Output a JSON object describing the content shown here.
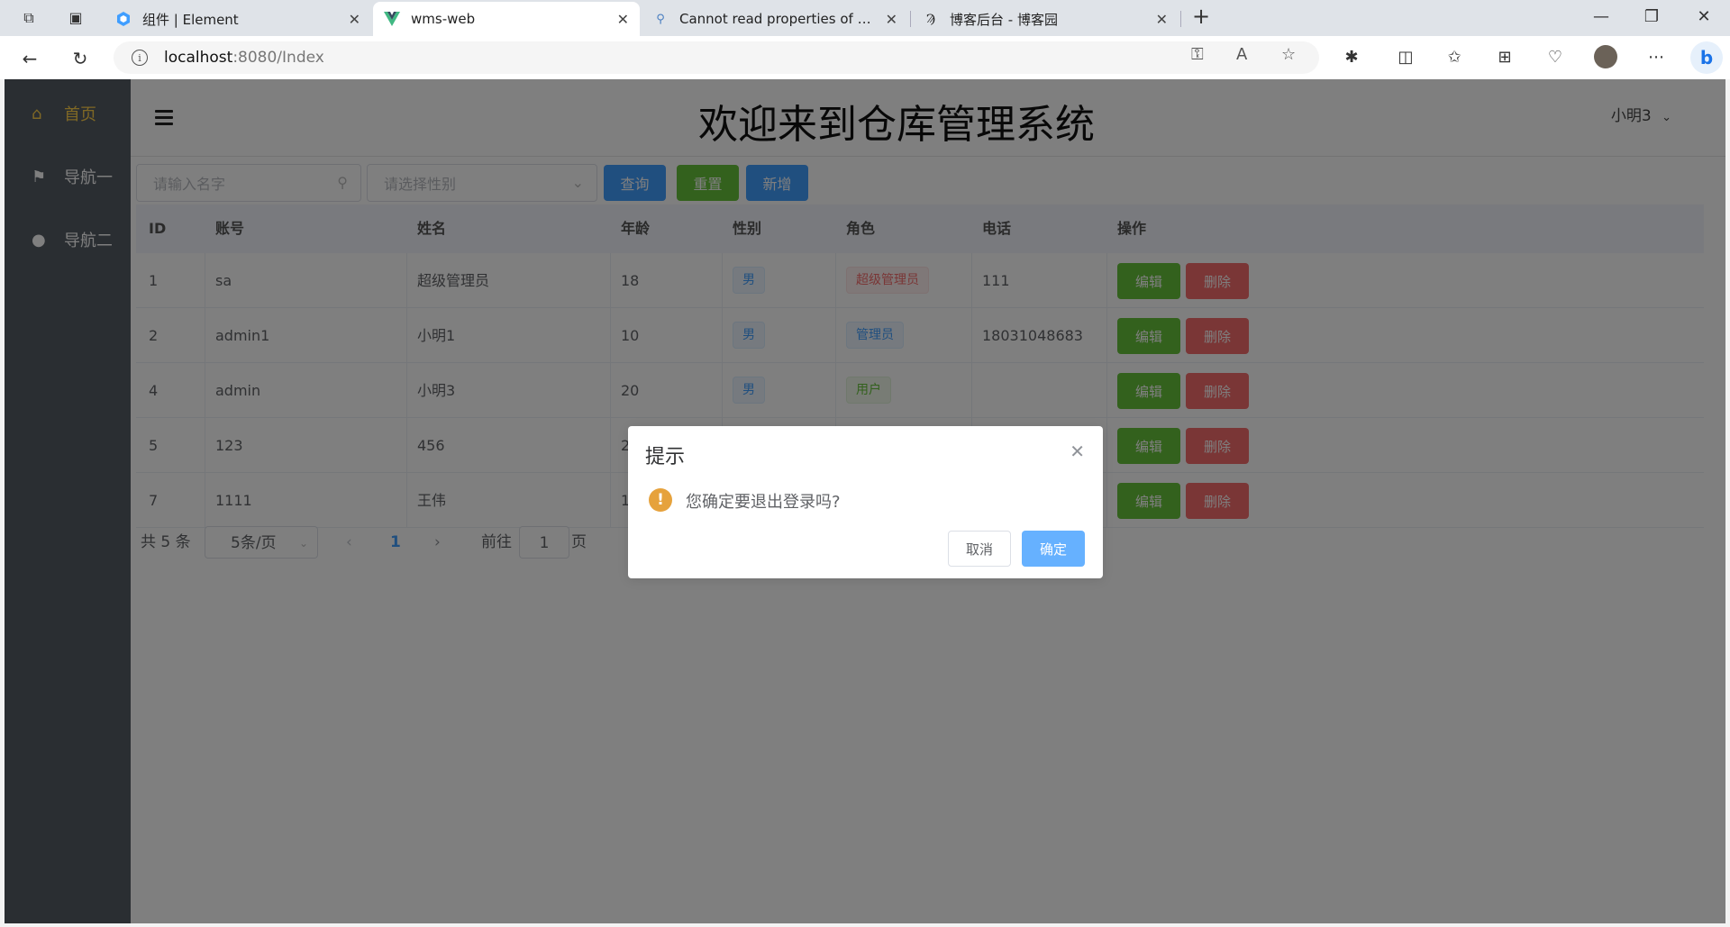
{
  "browser": {
    "tabs": [
      {
        "title": "组件 | Element",
        "icon": "element-icon"
      },
      {
        "title": "wms-web",
        "icon": "vue-icon"
      },
      {
        "title": "Cannot read properties of undefined",
        "icon": "search-icon"
      },
      {
        "title": "博客后台 - 博客园",
        "icon": "cnblogs-icon"
      }
    ],
    "url_host": "localhost",
    "url_path": ":8080/Index"
  },
  "sidebar": {
    "items": [
      {
        "label": "首页",
        "icon": "home-icon"
      },
      {
        "label": "导航一",
        "icon": "flag-icon"
      },
      {
        "label": "导航二",
        "icon": "location-icon"
      }
    ]
  },
  "header": {
    "title": "欢迎来到仓库管理系统",
    "user": "小明3"
  },
  "search": {
    "name_placeholder": "请输入名字",
    "sex_placeholder": "请选择性别",
    "query_label": "查询",
    "reset_label": "重置",
    "add_label": "新增"
  },
  "table": {
    "columns": [
      "ID",
      "账号",
      "姓名",
      "年龄",
      "性别",
      "角色",
      "电话",
      "操作"
    ],
    "rows": [
      {
        "id": "1",
        "account": "sa",
        "name": "超级管理员",
        "age": "18",
        "sex": "男",
        "role": "超级管理员",
        "phone": "111"
      },
      {
        "id": "2",
        "account": "admin1",
        "name": "小明1",
        "age": "10",
        "sex": "男",
        "role": "管理员",
        "phone": "18031048683"
      },
      {
        "id": "4",
        "account": "admin",
        "name": "小明3",
        "age": "20",
        "sex": "男",
        "role": "用户",
        "phone": ""
      },
      {
        "id": "5",
        "account": "123",
        "name": "456",
        "age": "2",
        "sex": "",
        "role": "",
        "phone": ""
      },
      {
        "id": "7",
        "account": "1111",
        "name": "王伟",
        "age": "1",
        "sex": "",
        "role": "",
        "phone": ""
      }
    ],
    "edit_label": "编辑",
    "delete_label": "删除"
  },
  "pagination": {
    "total": "共 5 条",
    "page_size": "5条/页",
    "current_page": "1",
    "goto_label": "前往",
    "goto_value": "1",
    "page_suffix": "页"
  },
  "dialog": {
    "title": "提示",
    "message": "您确定要退出登录吗?",
    "cancel_label": "取消",
    "confirm_label": "确定"
  },
  "colors": {
    "sidebar_bg": "#545c64",
    "active_menu": "#ffd04b",
    "primary": "#409eff",
    "success": "#67c23a",
    "danger": "#f56c6c",
    "warning": "#e6a23c"
  }
}
